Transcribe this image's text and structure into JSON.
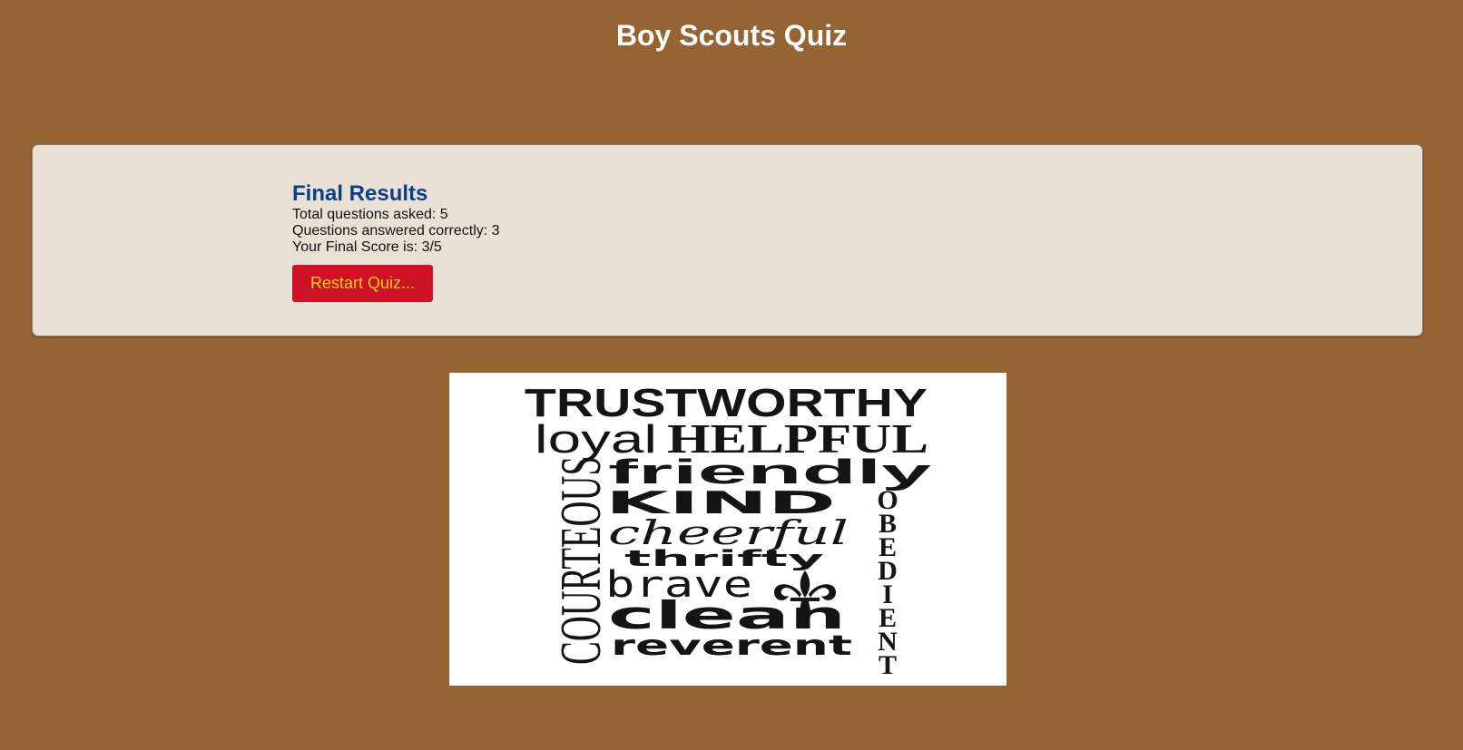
{
  "header": {
    "title": "Boy Scouts Quiz"
  },
  "results": {
    "heading": "Final Results",
    "total_asked": "Total questions asked: 5",
    "answered_correctly": "Questions answered correctly: 3",
    "final_score": "Your Final Score is: 3/5",
    "restart_label": "Restart Quiz..."
  },
  "poster": {
    "icon": "fleur-de-lis-icon",
    "words": {
      "trustworthy": "TRUSTWORTHY",
      "loyal": "loyal",
      "helpful": "HELPFUL",
      "friendly": "friendly",
      "kind": "KIND",
      "cheerful": "cheerful",
      "thrifty": "thrifty",
      "brave": "brave",
      "clean": "clean",
      "reverent": "reverent",
      "courteous": "COURTEOUS",
      "obedient": [
        "O",
        "B",
        "E",
        "D",
        "I",
        "E",
        "N",
        "T"
      ]
    }
  },
  "colors": {
    "background": "#966433",
    "card": "#e9e0d6",
    "heading": "#0e3d8a",
    "button": "#cf1126",
    "button_text": "#f7d117"
  }
}
